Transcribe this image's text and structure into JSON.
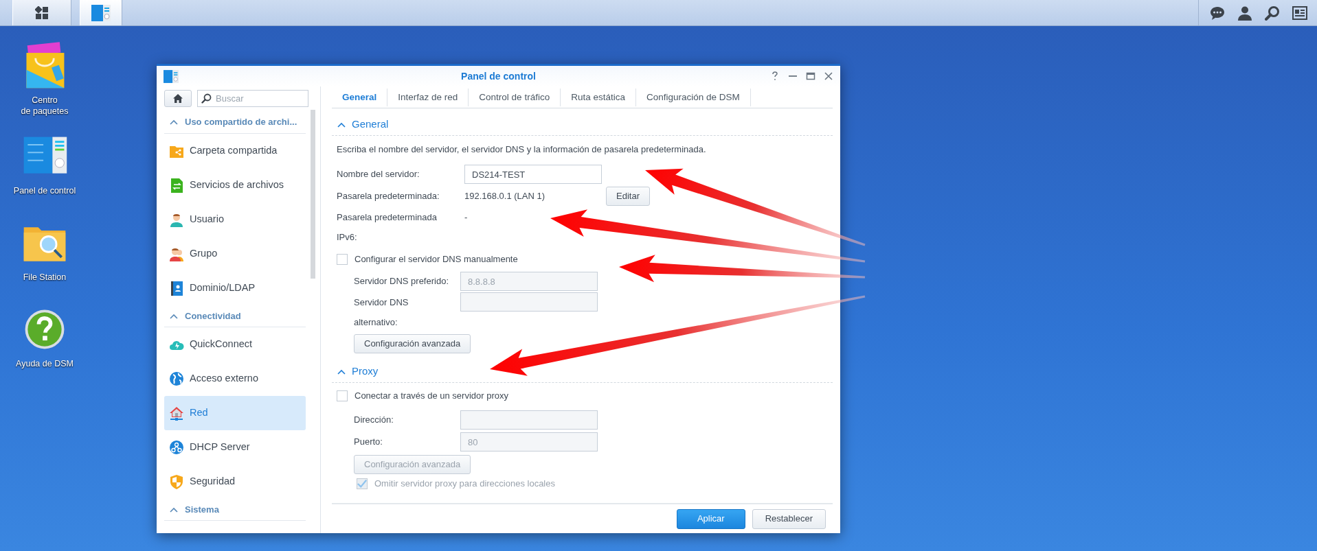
{
  "desktop_icons": [
    {
      "lines": [
        "Centro",
        "de paquetes"
      ]
    },
    {
      "lines": [
        "Panel de control"
      ]
    },
    {
      "lines": [
        "File Station"
      ]
    },
    {
      "lines": [
        "Ayuda de DSM"
      ]
    }
  ],
  "window": {
    "title": "Panel de control"
  },
  "sidebar": {
    "search": {
      "placeholder": "Buscar"
    },
    "sections": [
      {
        "title": "Uso compartido de archi...",
        "expanded": true,
        "items": [
          {
            "label": "Carpeta compartida",
            "selected": false
          },
          {
            "label": "Servicios de archivos",
            "selected": false
          },
          {
            "label": "Usuario",
            "selected": false
          },
          {
            "label": "Grupo",
            "selected": false
          },
          {
            "label": "Dominio/LDAP",
            "selected": false
          }
        ]
      },
      {
        "title": "Conectividad",
        "expanded": true,
        "items": [
          {
            "label": "QuickConnect",
            "selected": false
          },
          {
            "label": "Acceso externo",
            "selected": false
          },
          {
            "label": "Red",
            "selected": true
          },
          {
            "label": "DHCP Server",
            "selected": false
          },
          {
            "label": "Seguridad",
            "selected": false
          }
        ]
      },
      {
        "title": "Sistema",
        "expanded": true
      }
    ]
  },
  "tabs": [
    {
      "label": "General",
      "selected": true
    },
    {
      "label": "Interfaz de red",
      "selected": false
    },
    {
      "label": "Control de tráfico",
      "selected": false
    },
    {
      "label": "Ruta estática",
      "selected": false
    },
    {
      "label": "Configuración de DSM",
      "selected": false
    }
  ],
  "general": {
    "title": "General",
    "expanded": true,
    "description": "Escriba el nombre del servidor, el servidor DNS y la información de pasarela predeterminada.",
    "server_name": {
      "label": "Nombre del servidor:",
      "value": "DS214-TEST"
    },
    "gateway": {
      "label": "Pasarela predeterminada:",
      "value": "192.168.0.1 (LAN 1)",
      "button": "Editar"
    },
    "gateway_ipv6": {
      "label": "Pasarela predeterminada IPv6:",
      "value": "-"
    },
    "dns_manual": {
      "label": "Configurar el servidor DNS manualmente",
      "checked": false
    },
    "dns_preferred": {
      "label": "Servidor DNS preferido:",
      "value": "8.8.8.8",
      "disabled": true
    },
    "dns_alternate": {
      "label": "Servidor DNS alternativo:",
      "disabled": true
    },
    "advanced_button": {
      "label": "Configuración avanzada",
      "disabled": false
    }
  },
  "proxy": {
    "title": "Proxy",
    "expanded": true,
    "enable": {
      "label": "Conectar a través de un servidor proxy",
      "checked": false
    },
    "address": {
      "label": "Dirección:",
      "disabled": true
    },
    "port": {
      "label": "Puerto:",
      "value": "80",
      "disabled": true
    },
    "advanced_button": {
      "label": "Configuración avanzada",
      "disabled": true
    },
    "bypass_local": {
      "label": "Omitir servidor proxy para direcciones locales",
      "checked": true,
      "disabled": true
    }
  },
  "footer": {
    "buttons": [
      {
        "label": "Aplicar",
        "kind": "primary"
      },
      {
        "label": "Restablecer",
        "kind": "secondary"
      }
    ]
  }
}
